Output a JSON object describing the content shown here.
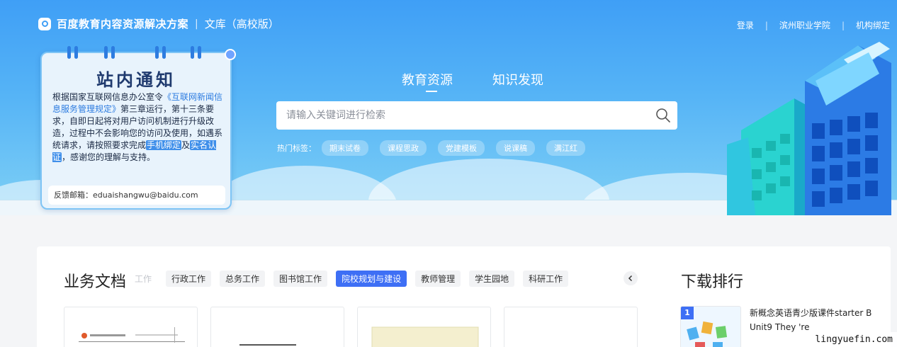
{
  "header": {
    "brand_title": "百度教育内容资源解决方案",
    "brand_separator": "|",
    "brand_subtitle": "文库（高校版）",
    "nav": {
      "login": "登录",
      "school": "滨州职业学院",
      "bind": "机构绑定",
      "separator": "|"
    }
  },
  "notice": {
    "title": "站内通知",
    "body_1": "根据国家互联网信息办公室令",
    "link": "《互联网新闻信息服务管理规定》",
    "body_2": "第三章运行，第十三条要求，自即日起将对用户访问机制进行升级改造，过程中不会影响您的访问及使用，如遇系统请求，请按照要求完成",
    "tag_phone": "手机绑定",
    "and": "及",
    "tag_realname": "实名认证",
    "body_3": "，感谢您的理解与支持。",
    "mail": "反馈邮箱：eduaishangwu@baidu.com"
  },
  "search": {
    "tabs": [
      "教育资源",
      "知识发现"
    ],
    "active_tab": "教育资源",
    "placeholder": "请输入关键词进行检索",
    "value": "",
    "hot_label": "热门标签：",
    "hot_tags": [
      "期末试卷",
      "课程思政",
      "党建模板",
      "说课稿",
      "满江红"
    ]
  },
  "main": {
    "section_title": "业务文档",
    "categories": [
      "工作",
      "行政工作",
      "总务工作",
      "图书馆工作",
      "院校规划与建设",
      "教师管理",
      "学生园地",
      "科研工作"
    ],
    "active_category": "院校规划与建设",
    "rank_title": "下载排行",
    "rank_items": [
      {
        "rank": "1",
        "title": "新概念英语青少版课件starter B Unit9 They 're"
      }
    ]
  },
  "watermark": "lingyuefin.com",
  "colors": {
    "accent": "#3e6ff5",
    "hero_top": "#3f9ff6",
    "hero_bottom": "#7fd0f5"
  }
}
